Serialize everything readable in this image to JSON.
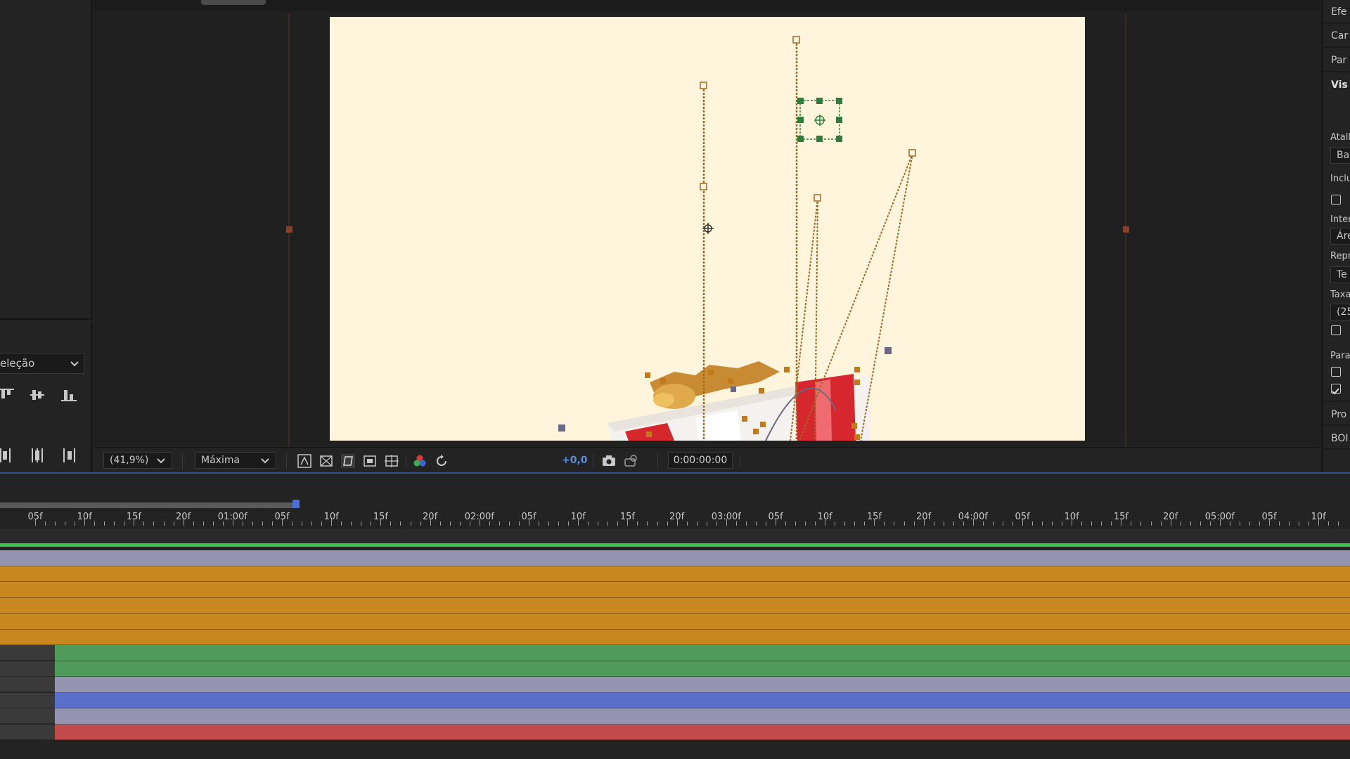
{
  "left_panel": {
    "align_dropdown": {
      "label": "eleção"
    },
    "align_icons_row1": [
      "align-top-icon",
      "align-vertical-center-icon",
      "align-bottom-icon"
    ],
    "align_icons_row2": [
      "distribute-left-icon",
      "distribute-horizontal-center-icon",
      "distribute-right-icon"
    ]
  },
  "viewer_toolbar": {
    "magnification": "(41,9%)",
    "resolution": "Máxima",
    "exposure": "+0,0",
    "timecode": "0:00:00:00",
    "icons": [
      "toggle-transparency-grid-icon",
      "region-of-interest-icon",
      "mask-path-visibility-icon",
      "target-region-icon",
      "grid-guides-icon",
      "channel-rgb-icon",
      "reset-exposure-icon",
      "snapshot-camera-icon",
      "show-snapshot-icon"
    ]
  },
  "right_panel": {
    "tabs": [
      "Efe",
      "Car",
      "Par",
      "Vis"
    ],
    "labels": [
      "Atall",
      "Inclu",
      "Inter",
      "Repr",
      "Taxa",
      "Para",
      "Pro",
      "BOI"
    ],
    "fields": [
      "Ba",
      "Áre",
      "Te",
      "(25"
    ],
    "checkboxes": [
      false,
      false,
      false,
      true
    ]
  },
  "timeline": {
    "ruler_labels": [
      "05f",
      "10f",
      "15f",
      "20f",
      "01:00f",
      "05f",
      "10f",
      "15f",
      "20f",
      "02:00f",
      "05f",
      "10f",
      "15f",
      "20f",
      "03:00f",
      "05f",
      "10f",
      "15f",
      "20f",
      "04:00f",
      "05f",
      "10f",
      "15f",
      "20f",
      "05:00f",
      "05f",
      "10f"
    ],
    "layer_colors": [
      "#9494b0",
      "#c8871f",
      "#c8871f",
      "#c8871f",
      "#c8871f",
      "#c8871f",
      "#4f9c5a",
      "#4f9c5a",
      "#9494b0",
      "#5a6fc9",
      "#9494b0",
      "#c24a4a"
    ]
  },
  "colors": {
    "canvas_bg": "#fff5dc",
    "path_orange": "#b8761e",
    "selection_green": "#2e7d3a",
    "playhead_blue": "#4a6fd8"
  }
}
